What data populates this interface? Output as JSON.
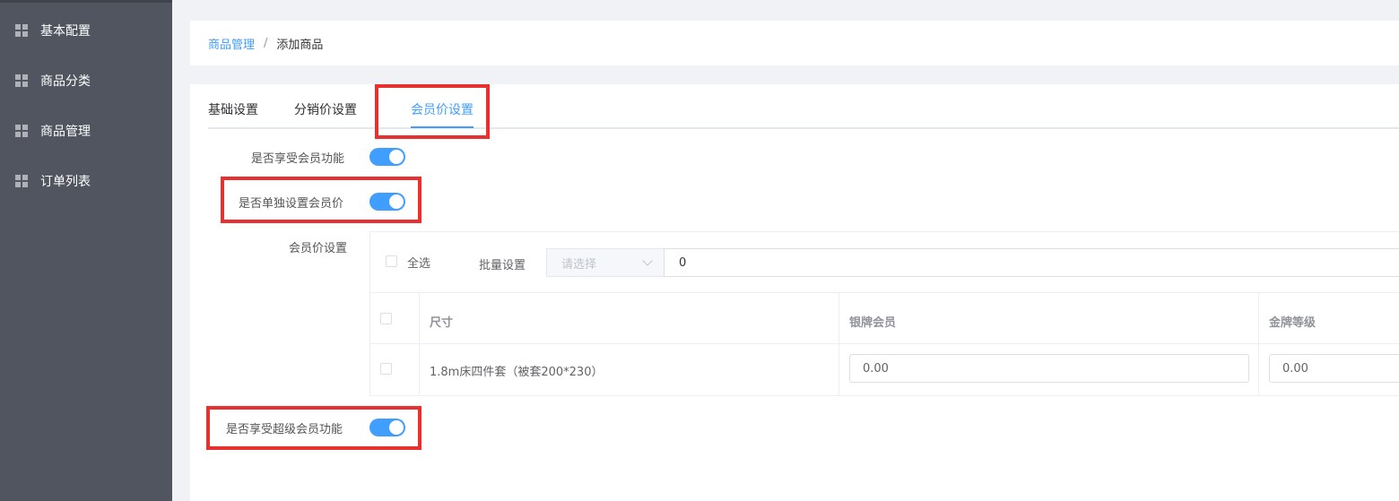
{
  "sidebar": {
    "items": [
      {
        "label": "基本配置",
        "icon": "grid-icon"
      },
      {
        "label": "商品分类",
        "icon": "grid-icon"
      },
      {
        "label": "商品管理",
        "icon": "grid-icon"
      },
      {
        "label": "订单列表",
        "icon": "grid-icon"
      }
    ]
  },
  "breadcrumb": {
    "parent": "商品管理",
    "separator": "/",
    "current": "添加商品"
  },
  "tabs": [
    {
      "label": "基础设置",
      "active": false
    },
    {
      "label": "分销价设置",
      "active": false
    },
    {
      "label": "会员价设置",
      "active": true
    }
  ],
  "form": {
    "enable_member": {
      "label": "是否享受会员功能",
      "on": true
    },
    "separate_member_price": {
      "label": "是否单独设置会员价",
      "on": true
    },
    "member_price_label": "会员价设置",
    "enable_super_member": {
      "label": "是否享受超级会员功能",
      "on": true
    }
  },
  "member_price_table": {
    "select_all_label": "全选",
    "batch_label": "批量设置",
    "batch_select_placeholder": "请选择",
    "batch_value": "0",
    "columns": [
      "尺寸",
      "银牌会员",
      "金牌等级"
    ],
    "rows": [
      {
        "size": "1.8m床四件套（被套200*230）",
        "silver": "0.00",
        "gold": "0.00"
      }
    ]
  },
  "colors": {
    "accent": "#409eff",
    "sidebar_bg": "#50555f",
    "highlight_box": "#e8312f"
  }
}
